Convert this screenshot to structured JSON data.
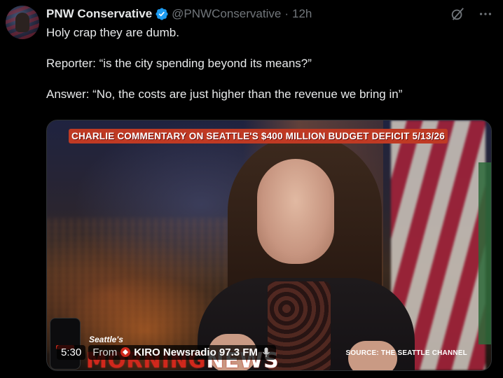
{
  "author": {
    "display_name": "PNW Conservative",
    "handle": "@PNWConservative",
    "separator": "·",
    "timestamp": "12h"
  },
  "tweet": {
    "line1": "Holy crap they are dumb.",
    "line2": "Reporter: “is the city spending beyond its means?”",
    "line3": "Answer: “No, the costs are just higher than the revenue we bring in”"
  },
  "video": {
    "banner": "CHARLIE COMMENTARY ON SEATTLE'S $400 MILLION BUDGET DEFICIT 5/13/26",
    "overlay_small": "Seattle's",
    "overlay_big_red": "MORNING",
    "overlay_big_white": "NEWS",
    "source_label": "SOURCE: THE SEATTLE CHANNEL",
    "duration": "5:30",
    "from_label": "From",
    "station": "KIRO Newsradio 97.3 FM"
  },
  "colors": {
    "verified_blue": "#1d9bf0",
    "banner_red": "#bf3a24",
    "secondary_text": "#71767b"
  },
  "icons": {
    "verified": "verified-badge-icon",
    "grok": "grok-icon",
    "more": "more-icon",
    "kiro": "kiro-logo-icon",
    "mic": "microphone-icon"
  }
}
